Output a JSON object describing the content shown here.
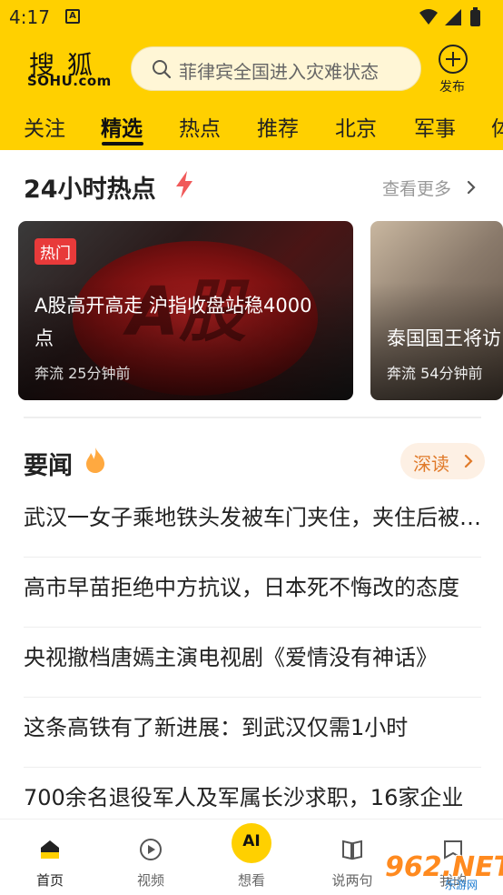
{
  "status_bar": {
    "time": "4:17",
    "notification_icon": "A",
    "icons": [
      "wifi-icon",
      "signal-icon",
      "battery-icon"
    ]
  },
  "header": {
    "logo_cn": "搜狐",
    "logo_en": "SOHU.com",
    "search_placeholder": "菲律宾全国进入灾难状态",
    "publish_label": "发布",
    "accent_color": "#FFD000"
  },
  "tabs": [
    {
      "label": "关注",
      "active": false
    },
    {
      "label": "精选",
      "active": true
    },
    {
      "label": "热点",
      "active": false
    },
    {
      "label": "推荐",
      "active": false
    },
    {
      "label": "北京",
      "active": false
    },
    {
      "label": "军事",
      "active": false
    },
    {
      "label": "体",
      "active": false
    }
  ],
  "hot24": {
    "title": "24小时热点",
    "more_label": "查看更多",
    "cards": [
      {
        "badge": "热门",
        "image_text": "A股",
        "title": "A股高开高走 沪指收盘站稳4000点",
        "source": "奔流",
        "time": "25分钟前"
      },
      {
        "title": "泰国国王将访",
        "source": "奔流",
        "time": "54分钟前"
      }
    ]
  },
  "news": {
    "title": "要闻",
    "deep_read_label": "深读",
    "items": [
      "武汉一女子乘地铁头发被车门夹住，夹住后被拖行",
      "高市早苗拒绝中方抗议，日本死不悔改的态度",
      "央视撤档唐嫣主演电视剧《爱情没有神话》",
      "这条高铁有了新进展：到武汉仅需1小时",
      "700余名退役军人及军属长沙求职，16家企业"
    ]
  },
  "bottom_nav": [
    {
      "label": "首页",
      "icon": "home-icon",
      "active": true
    },
    {
      "label": "视频",
      "icon": "play-icon",
      "active": false
    },
    {
      "label": "想看",
      "icon": "ai-icon",
      "active": false,
      "icon_text": "AI"
    },
    {
      "label": "说两句",
      "icon": "book-icon",
      "active": false
    },
    {
      "label": "我的",
      "icon": "profile-icon",
      "active": false
    }
  ],
  "watermark": {
    "text": "962.NET",
    "sub": "乐游网"
  }
}
